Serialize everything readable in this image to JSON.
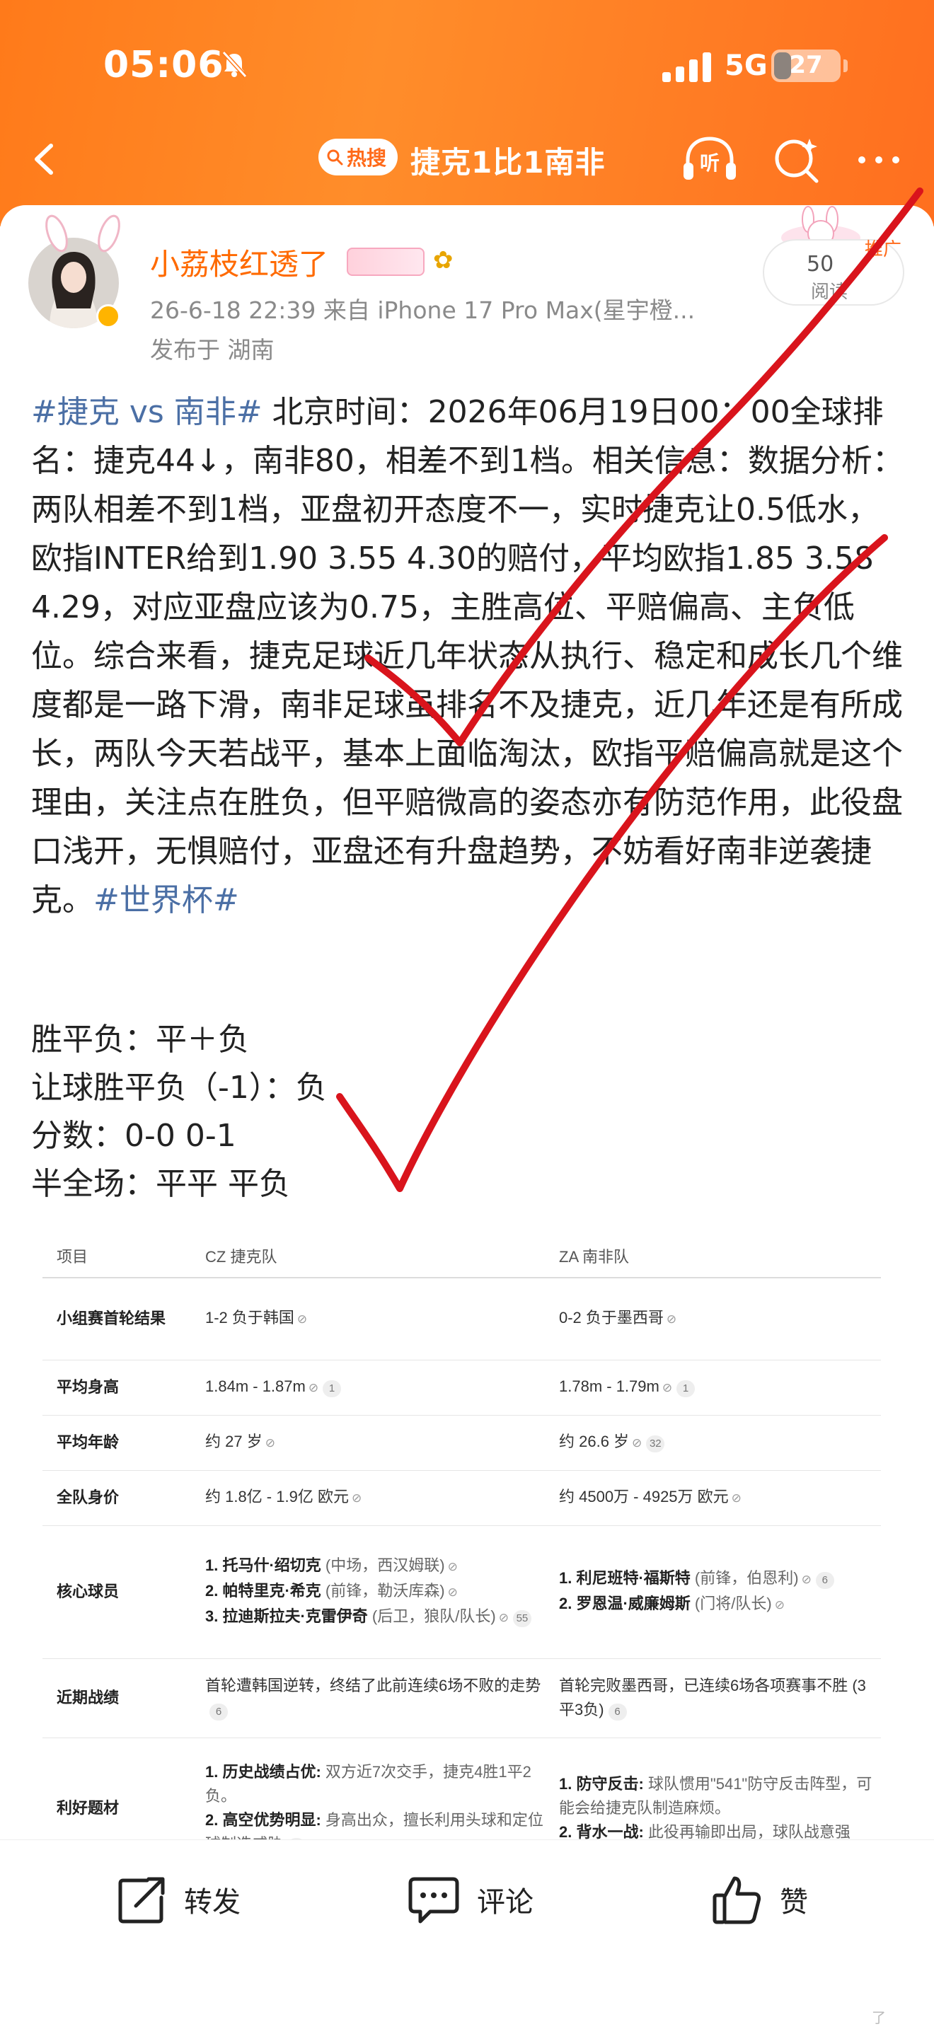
{
  "status": {
    "time": "05:06",
    "network": "5G",
    "battery": "27",
    "battery_level": 0.27
  },
  "nav": {
    "topic_chip": "热搜",
    "title": "捷克1比1南非",
    "icons": [
      "back-icon",
      "listen-icon",
      "search-sparkle-icon",
      "more-icon"
    ],
    "listen_glyph": "听"
  },
  "post": {
    "username": "小荔枝红透了",
    "meta": "26-6-18 22:39  来自 iPhone 17 Pro Max(星宇橙...",
    "location": "发布于 湖南",
    "reads": "50",
    "reads_label": "阅读",
    "ad_label": "推广",
    "tag_start": "#捷克 vs 南非#",
    "body": " 北京时间：2026年06月19日00：00全球排名：捷克44↓，南非80，相差不到1档。相关信息：数据分析：两队相差不到1档，亚盘初开态度不一，实时捷克让0.5低水，欧指INTER给到1.90 3.55 4.30的赔付，平均欧指1.85 3.58 4.29，对应亚盘应该为0.75，主胜高位、平赔偏高、主负低位。综合来看，捷克足球近几年状态从执行、稳定和成长几个维度都是一路下滑，南非足球虽排名不及捷克，近几年还是有所成长，两队今天若战平，基本上面临淘汰，欧指平赔偏高就是这个理由，关注点在胜负，但平赔微高的姿态亦有防范作用，此役盘口浅开，无惧赔付，亚盘还有升盘趋势，不妨看好南非逆袭捷克。",
    "tag_end": "#世界杯#",
    "picks": [
      "胜平负：平＋负",
      "让球胜平负（-1）：负",
      "分数：0-0 0-1",
      "半全场：平平 平负"
    ]
  },
  "table": {
    "headers": {
      "item": "项目",
      "cz": "CZ 捷克队",
      "za": "ZA 南非队"
    },
    "rows": [
      {
        "label": "小组赛首轮结果",
        "cz": "1-2 负于韩国",
        "za": "0-2 负于墨西哥"
      },
      {
        "label": "平均身高",
        "cz": "1.84m - 1.87m",
        "cz_ref": "1",
        "za": "1.78m - 1.79m",
        "za_ref": "1"
      },
      {
        "label": "平均年龄",
        "cz": "约 27 岁",
        "za": "约 26.6 岁",
        "za_ref": "32"
      },
      {
        "label": "全队身价",
        "cz": "约 1.8亿 - 1.9亿 欧元",
        "za": "约 4500万 - 4925万 欧元"
      },
      {
        "label": "核心球员",
        "cz_lines": [
          {
            "name": "1. 托马什·绍切克",
            "note": " (中场，西汉姆联)"
          },
          {
            "name": "2. 帕特里克·希克",
            "note": " (前锋，勒沃库森)"
          },
          {
            "name": "3. 拉迪斯拉夫·克雷伊奇",
            "note": " (后卫，狼队/队长)"
          }
        ],
        "cz_ref": "55",
        "za_lines": [
          {
            "name": "1. 利尼班特·福斯特",
            "note": " (前锋，伯恩利)"
          },
          {
            "name": "2. 罗恩温·威廉姆斯",
            "note": " (门将/队长)"
          }
        ],
        "za_ref": "6"
      },
      {
        "label": "近期战绩",
        "cz": "首轮遭韩国逆转，终结了此前连续6场不败的走势",
        "cz_ref": "6",
        "za": "首轮完败墨西哥，已连续6场各项赛事不胜 (3平3负)",
        "za_ref": "6"
      },
      {
        "label": "利好题材",
        "cz_lines": [
          {
            "name": "1. 历史战绩占优:",
            "note": " 双方近7次交手，捷克4胜1平2负。"
          },
          {
            "name": "2. 高空优势明显:",
            "note": " 身高出众，擅长利用头球和定位球制造威胁"
          }
        ],
        "cz_ref": "1",
        "za_lines": [
          {
            "name": "1. 防守反击:",
            "note": " 球队惯用\"541\"防守反击阵型，可能会给捷克队制造麻烦。"
          },
          {
            "name": "2. 背水一战:",
            "note": " 此役再输即出局，球队战意强"
          }
        ]
      }
    ]
  },
  "actions": {
    "repost": "转发",
    "comment": "评论",
    "like": "赞"
  },
  "colors": {
    "header": "#ff7a1a",
    "username": "#ff6a00",
    "tag": "#4b6fa5",
    "check": "#d9141c"
  }
}
